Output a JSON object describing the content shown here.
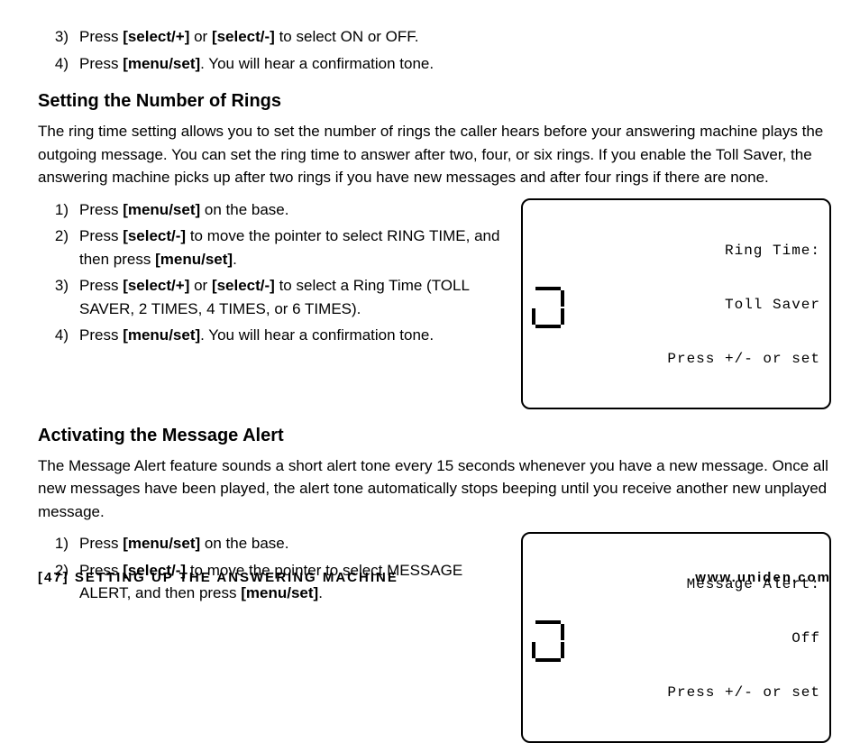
{
  "intro_steps": [
    {
      "n": "3)",
      "before": "Press ",
      "b1": "[select/+]",
      "mid": " or ",
      "b2": "[select/-]",
      "after": " to select ON or OFF."
    },
    {
      "n": "4)",
      "before": "Press ",
      "b1": "[menu/set]",
      "mid": "",
      "b2": "",
      "after": ". You will hear a confirmation tone."
    }
  ],
  "sec1": {
    "title": "Setting the Number of Rings",
    "para": "The ring time setting allows you to set the number of rings the caller hears before your answering machine plays the outgoing message. You can set the ring time to answer after two, four, or six rings. If you enable the Toll Saver, the answering machine picks up after two rings if you have new messages and after four rings if there are none.",
    "steps": [
      {
        "n": "1)",
        "pre": "Press ",
        "b1": "[menu/set]",
        "mid": " on the base.",
        "b2": "",
        "post": ""
      },
      {
        "n": "2)",
        "pre": "Press ",
        "b1": "[select/-]",
        "mid": " to move the pointer to select RING TIME, and then press ",
        "b2": "[menu/set]",
        "post": "."
      },
      {
        "n": "3)",
        "pre": "Press ",
        "b1": "[select/+]",
        "mid": " or ",
        "b2": "[select/-]",
        "post": " to select a Ring Time (TOLL SAVER, 2 TIMES, 4 TIMES, or 6 TIMES)."
      },
      {
        "n": "4)",
        "pre": "Press ",
        "b1": "[menu/set]",
        "mid": ". You will hear a confirmation tone.",
        "b2": "",
        "post": ""
      }
    ],
    "lcd": {
      "l1": "Ring Time:",
      "l2": "Toll Saver",
      "l3": "Press +/- or set"
    }
  },
  "sec2": {
    "title": "Activating the Message Alert",
    "para": "The Message Alert feature sounds a short alert tone every 15 seconds whenever you have a new message. Once all new messages have been played, the alert tone automatically stops beeping until you receive another new unplayed message.",
    "steps": [
      {
        "n": "1)",
        "pre": "Press ",
        "b1": "[menu/set]",
        "mid": " on the base.",
        "b2": "",
        "post": ""
      },
      {
        "n": "2)",
        "pre": "Press ",
        "b1": "[select/-]",
        "mid": " to move the pointer to select MESSAGE ALERT, and then press ",
        "b2": "[menu/set]",
        "post": "."
      }
    ],
    "lcd": {
      "l1": "Message Alert:",
      "l2": "Off",
      "l3": "Press +/- or set"
    }
  },
  "footer": {
    "left": "[47] SETTING UP THE ANSWERING MACHINE",
    "right": "www.uniden.com"
  }
}
